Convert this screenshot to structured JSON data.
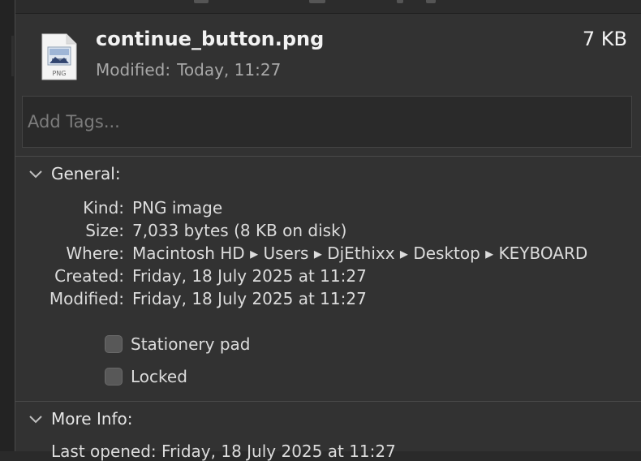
{
  "file": {
    "name": "continue_button.png",
    "size": "7 KB",
    "modified_label": "Modified:",
    "modified_value": "Today, 11:27",
    "icon": "png-file-icon",
    "icon_label": "PNG"
  },
  "tags": {
    "placeholder": "Add Tags..."
  },
  "general": {
    "title": "General:",
    "rows": [
      {
        "key": "Kind:",
        "value": "PNG image"
      },
      {
        "key": "Size:",
        "value": "7,033 bytes (8 KB on disk)"
      },
      {
        "key": "Where:",
        "value": "Macintosh HD ▸ Users ▸ DjEthixx ▸ Desktop ▸ KEYBOARD"
      },
      {
        "key": "Created:",
        "value": "Friday, 18 July 2025 at 11:27"
      },
      {
        "key": "Modified:",
        "value": "Friday, 18 July 2025 at 11:27"
      }
    ],
    "stationery_label": "Stationery pad",
    "locked_label": "Locked"
  },
  "more_info": {
    "title": "More Info:",
    "last_opened": "Last opened: Friday, 18 July 2025 at 11:27"
  },
  "colors": {
    "panel": "#323232",
    "text": "#dcdcdc",
    "muted": "#a8a8a8"
  }
}
